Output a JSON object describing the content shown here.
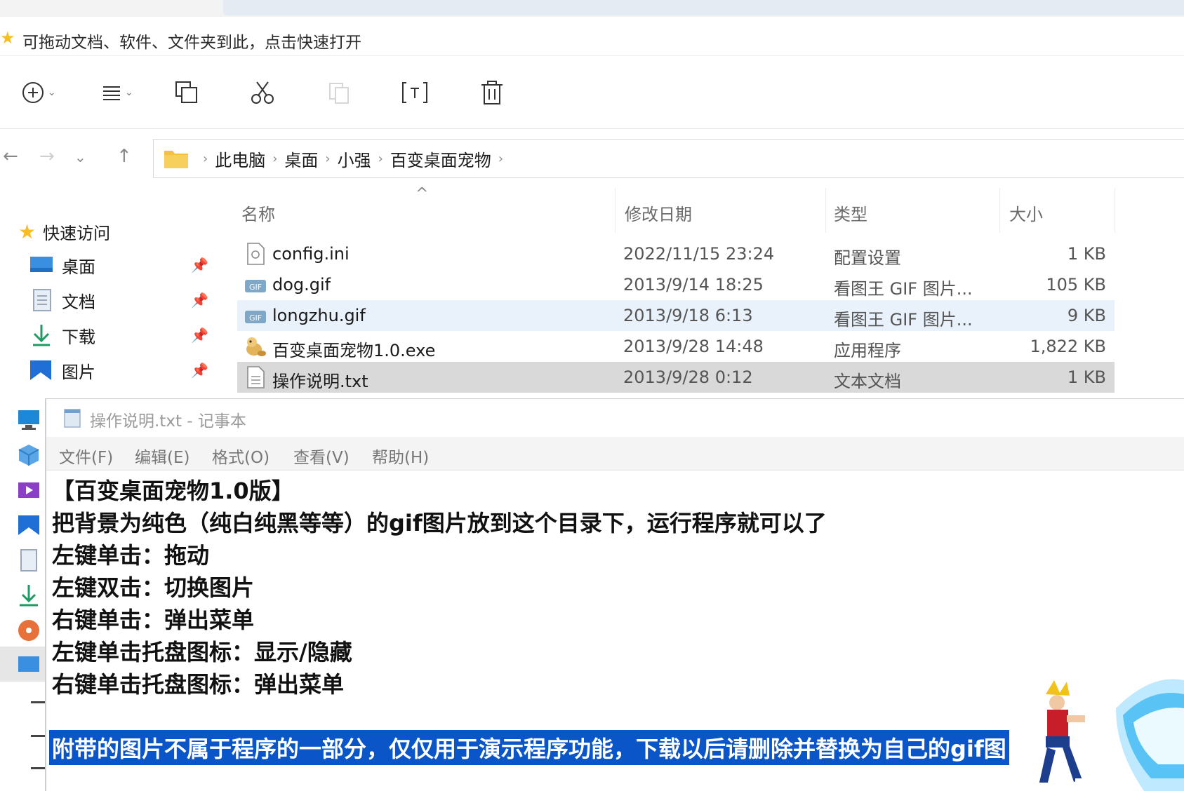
{
  "quickbar": {
    "hint": "可拖动文档、软件、文件夹到此，点击快速打开"
  },
  "toolbar": {
    "icons": [
      "new-icon",
      "view-icon",
      "copy-icon",
      "cut-icon",
      "paste-icon",
      "rename-icon",
      "delete-icon"
    ]
  },
  "address": {
    "crumbs": [
      "此电脑",
      "桌面",
      "小强",
      "百变桌面宠物"
    ]
  },
  "sidebar": {
    "quick_access": "快速访问",
    "items": [
      {
        "label": "桌面",
        "icon": "desktop-icon"
      },
      {
        "label": "文档",
        "icon": "documents-icon"
      },
      {
        "label": "下载",
        "icon": "download-icon"
      },
      {
        "label": "图片",
        "icon": "pictures-icon"
      }
    ]
  },
  "filelist": {
    "columns": [
      "名称",
      "修改日期",
      "类型",
      "大小"
    ],
    "files": [
      {
        "name": "config.ini",
        "date": "2022/11/15 23:24",
        "type": "配置设置",
        "size": "1 KB",
        "icon": "ini-file-icon"
      },
      {
        "name": "dog.gif",
        "date": "2013/9/14 18:25",
        "type": "看图王 GIF 图片...",
        "size": "105 KB",
        "icon": "gif-file-icon"
      },
      {
        "name": "longzhu.gif",
        "date": "2013/9/18 6:13",
        "type": "看图王 GIF 图片...",
        "size": "9 KB",
        "icon": "gif-file-icon"
      },
      {
        "name": "百变桌面宠物1.0.exe",
        "date": "2013/9/28 14:48",
        "type": "应用程序",
        "size": "1,822 KB",
        "icon": "app-exe-icon"
      },
      {
        "name": "操作说明.txt",
        "date": "2013/9/28 0:12",
        "type": "文本文档",
        "size": "1 KB",
        "icon": "txt-file-icon"
      }
    ]
  },
  "notepad": {
    "title": "操作说明.txt - 记事本",
    "menu": [
      "文件(F)",
      "编辑(E)",
      "格式(O)",
      "查看(V)",
      "帮助(H)"
    ],
    "lines": [
      "【百变桌面宠物1.0版】",
      "把背景为纯色（纯白纯黑等等）的gif图片放到这个目录下，运行程序就可以了",
      "左键单击：拖动",
      "左键双击：切换图片",
      "右键单击：弹出菜单",
      "左键单击托盘图标：显示/隐藏",
      "右键单击托盘图标：弹出菜单",
      "",
      "附带的图片不属于程序的一部分，仅仅用于演示程序功能，下载以后请删除并替换为自己的gif图"
    ]
  },
  "colors": {
    "selection": "#0a56c8",
    "row_selected": "#d9d9d9",
    "row_hover": "#e9f1fb",
    "folder": "#f4c042"
  }
}
